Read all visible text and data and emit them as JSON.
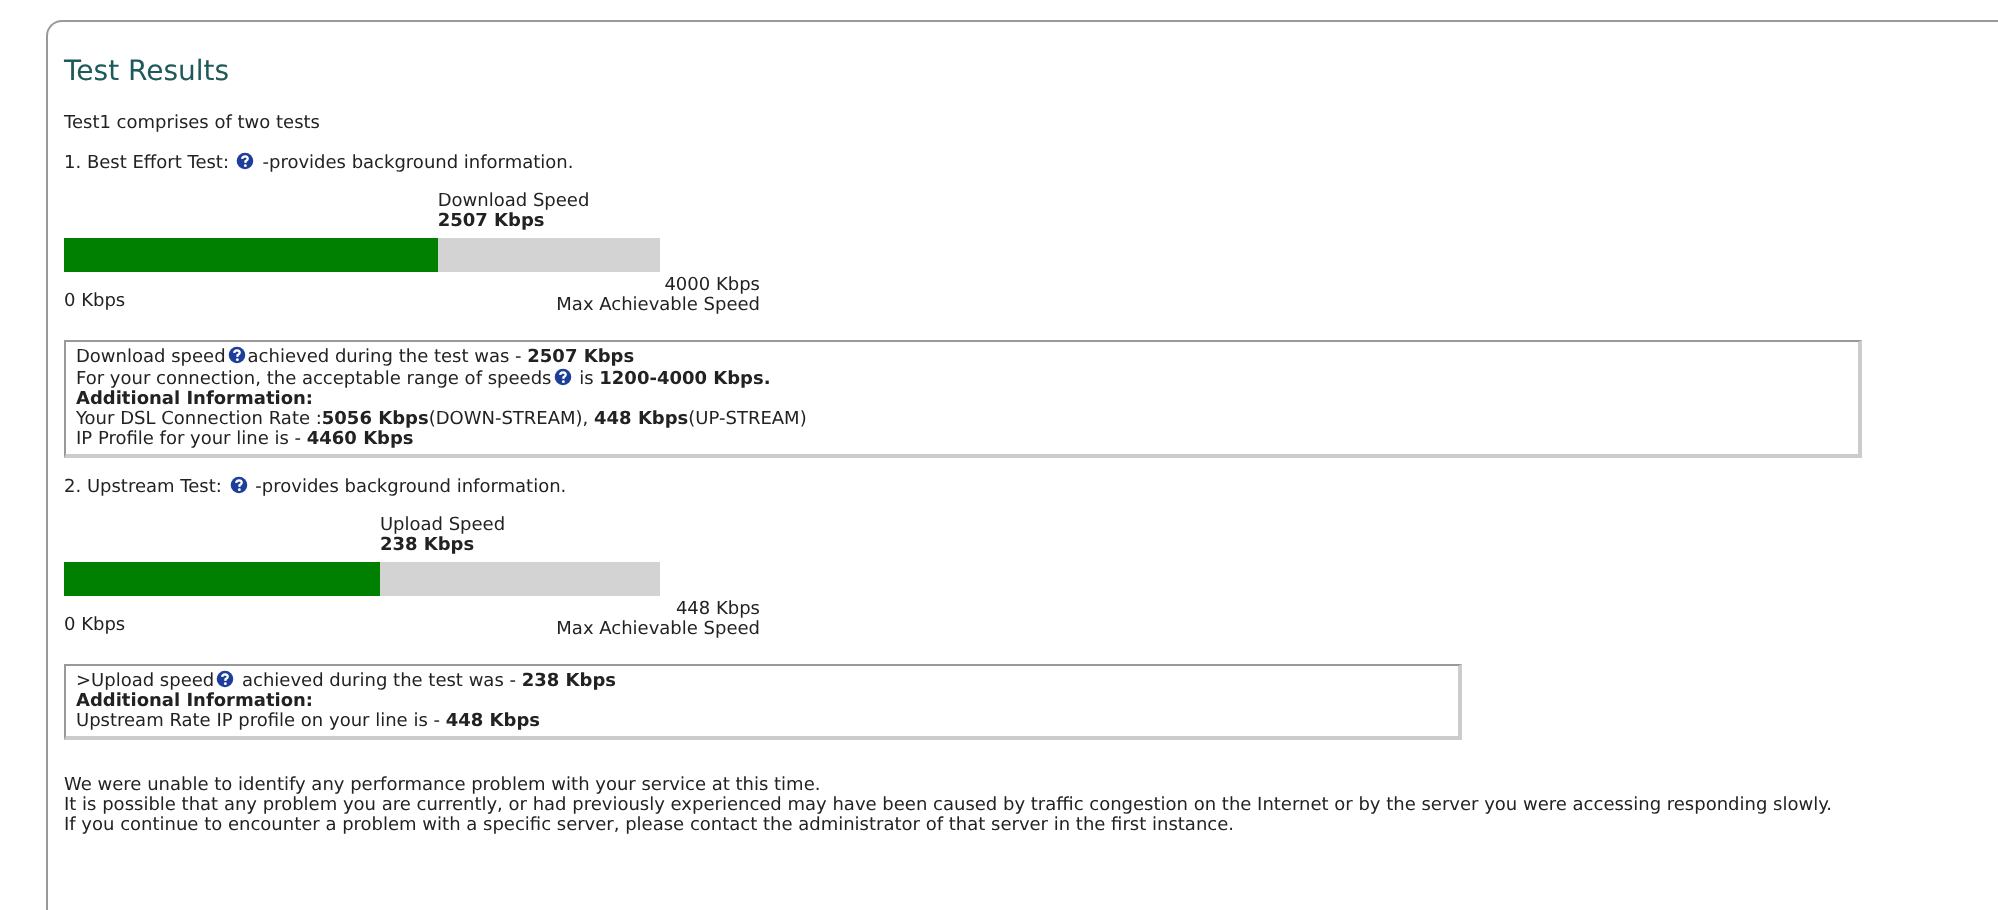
{
  "title": "Test Results",
  "intro": "Test1 comprises of two tests",
  "tests": [
    {
      "heading_before": "1. Best Effort Test:",
      "heading_after": "-provides background information.",
      "gauge_label": "Download  Speed",
      "gauge_value": "2507 Kbps",
      "level": 0.627,
      "min_label": "0 Kbps",
      "max_label": "4000 Kbps",
      "max_caption": "Max Achievable Speed",
      "info": [
        {
          "parts": [
            "Download speed",
            "achieved during the test was - **2507 Kbps**"
          ]
        },
        {
          "parts": [
            "For your connection, the acceptable range of speeds",
            " is **1200-4000 Kbps.**"
          ]
        },
        {
          "parts": [
            "**Additional Information:**"
          ]
        },
        {
          "parts": [
            "Your DSL Connection Rate :**5056 Kbps**(DOWN-STREAM), **448 Kbps**(UP-STREAM)"
          ]
        },
        {
          "parts": [
            "IP Profile for your line is - **4460 Kbps**"
          ]
        }
      ]
    },
    {
      "heading_before": "2. Upstream Test:",
      "heading_after": "-provides background information.",
      "gauge_label": "Upload Speed",
      "gauge_value": "238 Kbps",
      "level": 0.53,
      "min_label": "0 Kbps",
      "max_label": "448 Kbps",
      "max_caption": "Max Achievable Speed",
      "info": [
        {
          "parts": [
            ">Upload speed",
            " achieved during the test was - **238 Kbps**"
          ]
        },
        {
          "parts": [
            "**Additional Information:**"
          ]
        },
        {
          "parts": [
            "Upstream Rate IP profile on your line is - **448 Kbps**"
          ]
        }
      ]
    }
  ],
  "footer": [
    "We were unable to identify any performance problem with your service at this time.",
    "It is possible that any problem you are currently, or had previously experienced may have been caused by traffic congestion on the Internet or by the server you were accessing responding slowly.",
    "If you continue to encounter a problem with a specific server, please contact the administrator of that server in the first instance."
  ]
}
